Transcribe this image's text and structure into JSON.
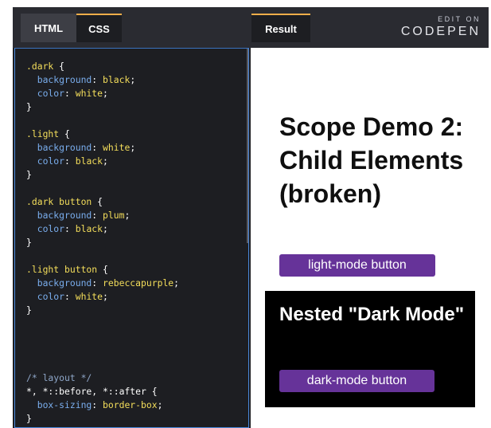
{
  "tabs": {
    "html": "HTML",
    "css": "CSS",
    "result": "Result"
  },
  "codepen": {
    "edit_on": "EDIT ON",
    "name": "CODEPEN"
  },
  "code": {
    "l1_sel": ".dark",
    "l1_br": " {",
    "l2_prop": "  background",
    "l2_val": "black",
    "l3_prop": "  color",
    "l3_val": "white",
    "l4": "}",
    "l6_sel": ".light",
    "l6_br": " {",
    "l7_prop": "  background",
    "l7_val": "white",
    "l8_prop": "  color",
    "l8_val": "black",
    "l9": "}",
    "l11_sel": ".dark button",
    "l11_br": " {",
    "l12_prop": "  background",
    "l12_val": "plum",
    "l13_prop": "  color",
    "l13_val": "black",
    "l14": "}",
    "l16_sel": ".light button",
    "l16_br": " {",
    "l17_prop": "  background",
    "l17_val": "rebeccapurple",
    "l18_prop": "  color",
    "l18_val": "white",
    "l19": "}",
    "l24_cmt": "/* layout */",
    "l25_sel": "*, *::before, *::after",
    "l25_br": " {",
    "l26_prop": "  box-sizing",
    "l26_val": "border-box",
    "l27": "}"
  },
  "result": {
    "title": "Scope Demo 2: Child Elements (broken)",
    "light_button": "light-mode button",
    "dark_heading": "Nested \"Dark Mode\"",
    "dark_button": "dark-mode button"
  },
  "colors": {
    "accent_tab": "#f0ae4a",
    "button_bg": "#663399",
    "editor_bg": "#1d1e22"
  }
}
